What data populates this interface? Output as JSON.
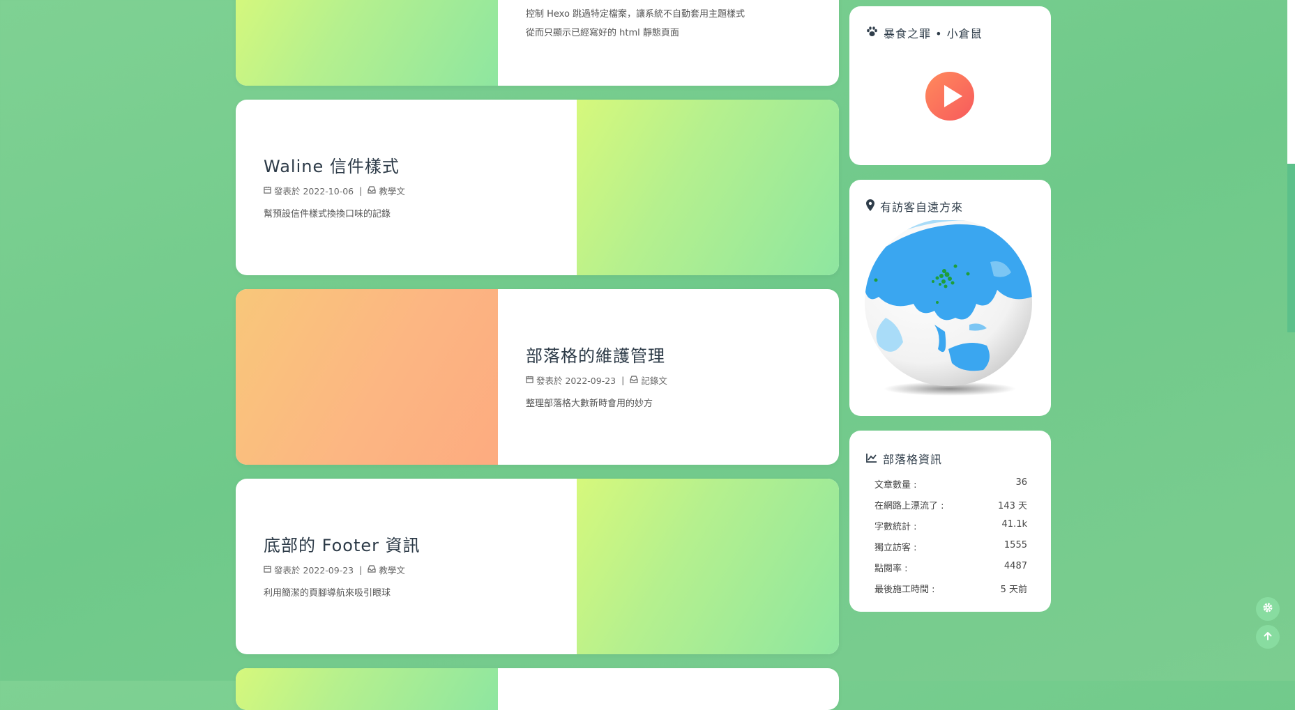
{
  "posts": [
    {
      "desc_line1": "控制 Hexo 跳過特定檔案，讓系統不自動套用主題樣式",
      "desc_line2": "從而只顯示已經寫好的 html 靜態頁面"
    },
    {
      "title": "Waline 信件樣式",
      "date": "發表於 2022-10-06",
      "category": "教學文",
      "desc": "幫預設信件樣式換換口味的記錄"
    },
    {
      "title": "部落格的維護管理",
      "date": "發表於 2022-09-23",
      "category": "記錄文",
      "desc": "整理部落格大數新時會用的妙方"
    },
    {
      "title": "底部的 Footer 資訊",
      "date": "發表於 2022-09-23",
      "category": "教學文",
      "desc": "利用簡潔的頁腳導航來吸引眼球"
    }
  ],
  "sidebar": {
    "music": {
      "title": "暴食之罪 • 小倉鼠",
      "icon": "paw-icon"
    },
    "globe": {
      "title": "有訪客自遠方來",
      "icon": "map-marker-icon"
    },
    "stats": {
      "title": "部落格資訊",
      "icon": "line-chart-icon",
      "rows": [
        {
          "label": "文章數量 :",
          "value": "36"
        },
        {
          "label": "在網路上漂流了 :",
          "value": "143 天"
        },
        {
          "label": "字數統計 :",
          "value": "41.1k"
        },
        {
          "label": "獨立訪客 :",
          "value": "1555"
        },
        {
          "label": "點閱率 :",
          "value": "4487"
        },
        {
          "label": "最後施工時間 :",
          "value": "5 天前"
        }
      ]
    }
  },
  "icons": {
    "meta_date": "calendar-icon",
    "meta_category": "inbox-icon",
    "settings": "gear-icon",
    "back_to_top": "arrow-up-icon"
  },
  "colors": {
    "background": "#72cb8d",
    "card": "#ffffff",
    "cover_green_start": "#d6f87c",
    "cover_green_end": "#8ee6a0",
    "cover_orange_start": "#f8c77a",
    "cover_orange_end": "#fdab80",
    "play_button": "#f86a5c",
    "map_land": "#3aa6f0",
    "visitor_dot": "#1e9e3a"
  }
}
